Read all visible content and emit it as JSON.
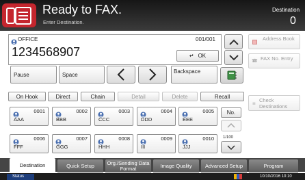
{
  "header": {
    "title": "Ready to FAX.",
    "subtitle": "Enter Destination.",
    "destination_label": "Destination",
    "destination_count": "0"
  },
  "entry": {
    "name": "OFFICE",
    "page": "001/001",
    "number": "1234568907",
    "ok_label": "OK"
  },
  "keys": {
    "pause": "Pause",
    "space": "Space",
    "backspace": "Backspace"
  },
  "right_panel": {
    "address_book": "Address Book",
    "fax_no_entry": "FAX No. Entry",
    "check_destinations": "Check Destinations"
  },
  "function_row": {
    "on_hook": "On Hook",
    "direct": "Direct",
    "chain": "Chain",
    "detail": "Detail",
    "delete": "Delete",
    "recall": "Recall"
  },
  "speed_dials": [
    {
      "num": "0001",
      "name": "AAA"
    },
    {
      "num": "0002",
      "name": "BBB"
    },
    {
      "num": "0003",
      "name": "CCC"
    },
    {
      "num": "0004",
      "name": "DDD"
    },
    {
      "num": "0005",
      "name": "EEE"
    },
    {
      "num": "0006",
      "name": "FFF"
    },
    {
      "num": "0007",
      "name": "GGG"
    },
    {
      "num": "0008",
      "name": "HHH"
    },
    {
      "num": "0009",
      "name": "III"
    },
    {
      "num": "0010",
      "name": "JJJ"
    }
  ],
  "pager": {
    "no_label": "No.",
    "page": "1/100"
  },
  "tabs": [
    {
      "label": "Destination"
    },
    {
      "label": "Quick Setup"
    },
    {
      "label": "Org./Sending Data Format"
    },
    {
      "label": "Image Quality"
    },
    {
      "label": "Advanced Setup"
    },
    {
      "label": "Program"
    }
  ],
  "status": {
    "label": "Status",
    "datetime": "10/10/2016  10:10"
  },
  "colors": {
    "accent_red": "#c4262e",
    "header_dark": "#161616"
  },
  "icons": [
    "fax-icon",
    "contact-icon",
    "arrow-up-icon",
    "arrow-down-icon",
    "arrow-left-icon",
    "arrow-right-icon",
    "enter-icon",
    "book-icon",
    "address-book-icon",
    "fax-number-icon",
    "list-icon"
  ]
}
